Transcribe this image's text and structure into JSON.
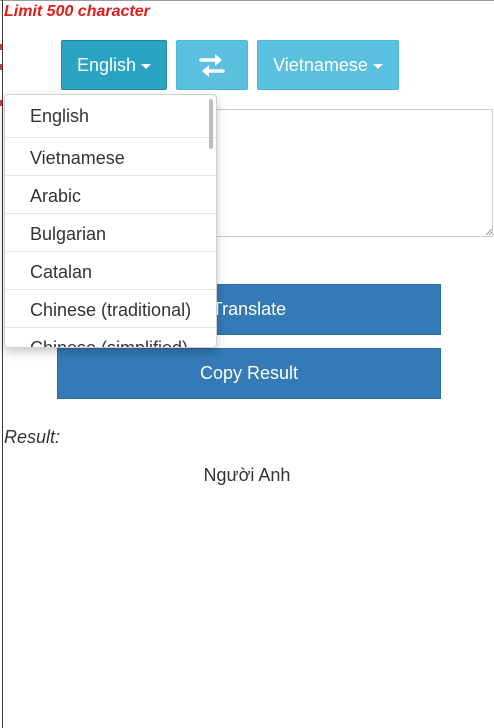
{
  "limit_note": "Limit 500 character",
  "toolbar": {
    "source_language": "English",
    "target_language": "Vietnamese",
    "swap_icon": "swap-arrows-icon"
  },
  "input": {
    "value": "",
    "placeholder": ""
  },
  "dropdown": {
    "items": [
      "English",
      "Vietnamese",
      "Arabic",
      "Bulgarian",
      "Catalan",
      "Chinese (traditional)",
      "Chinese (simplified)"
    ]
  },
  "actions": {
    "translate_label": "Translate",
    "copy_label": "Copy Result"
  },
  "result": {
    "label": "Result:",
    "text": "Người Anh"
  },
  "colors": {
    "note": "#e31b1b",
    "source_button": "#2aa4c2",
    "info_button": "#5bc0de",
    "primary_button": "#337ab7"
  }
}
